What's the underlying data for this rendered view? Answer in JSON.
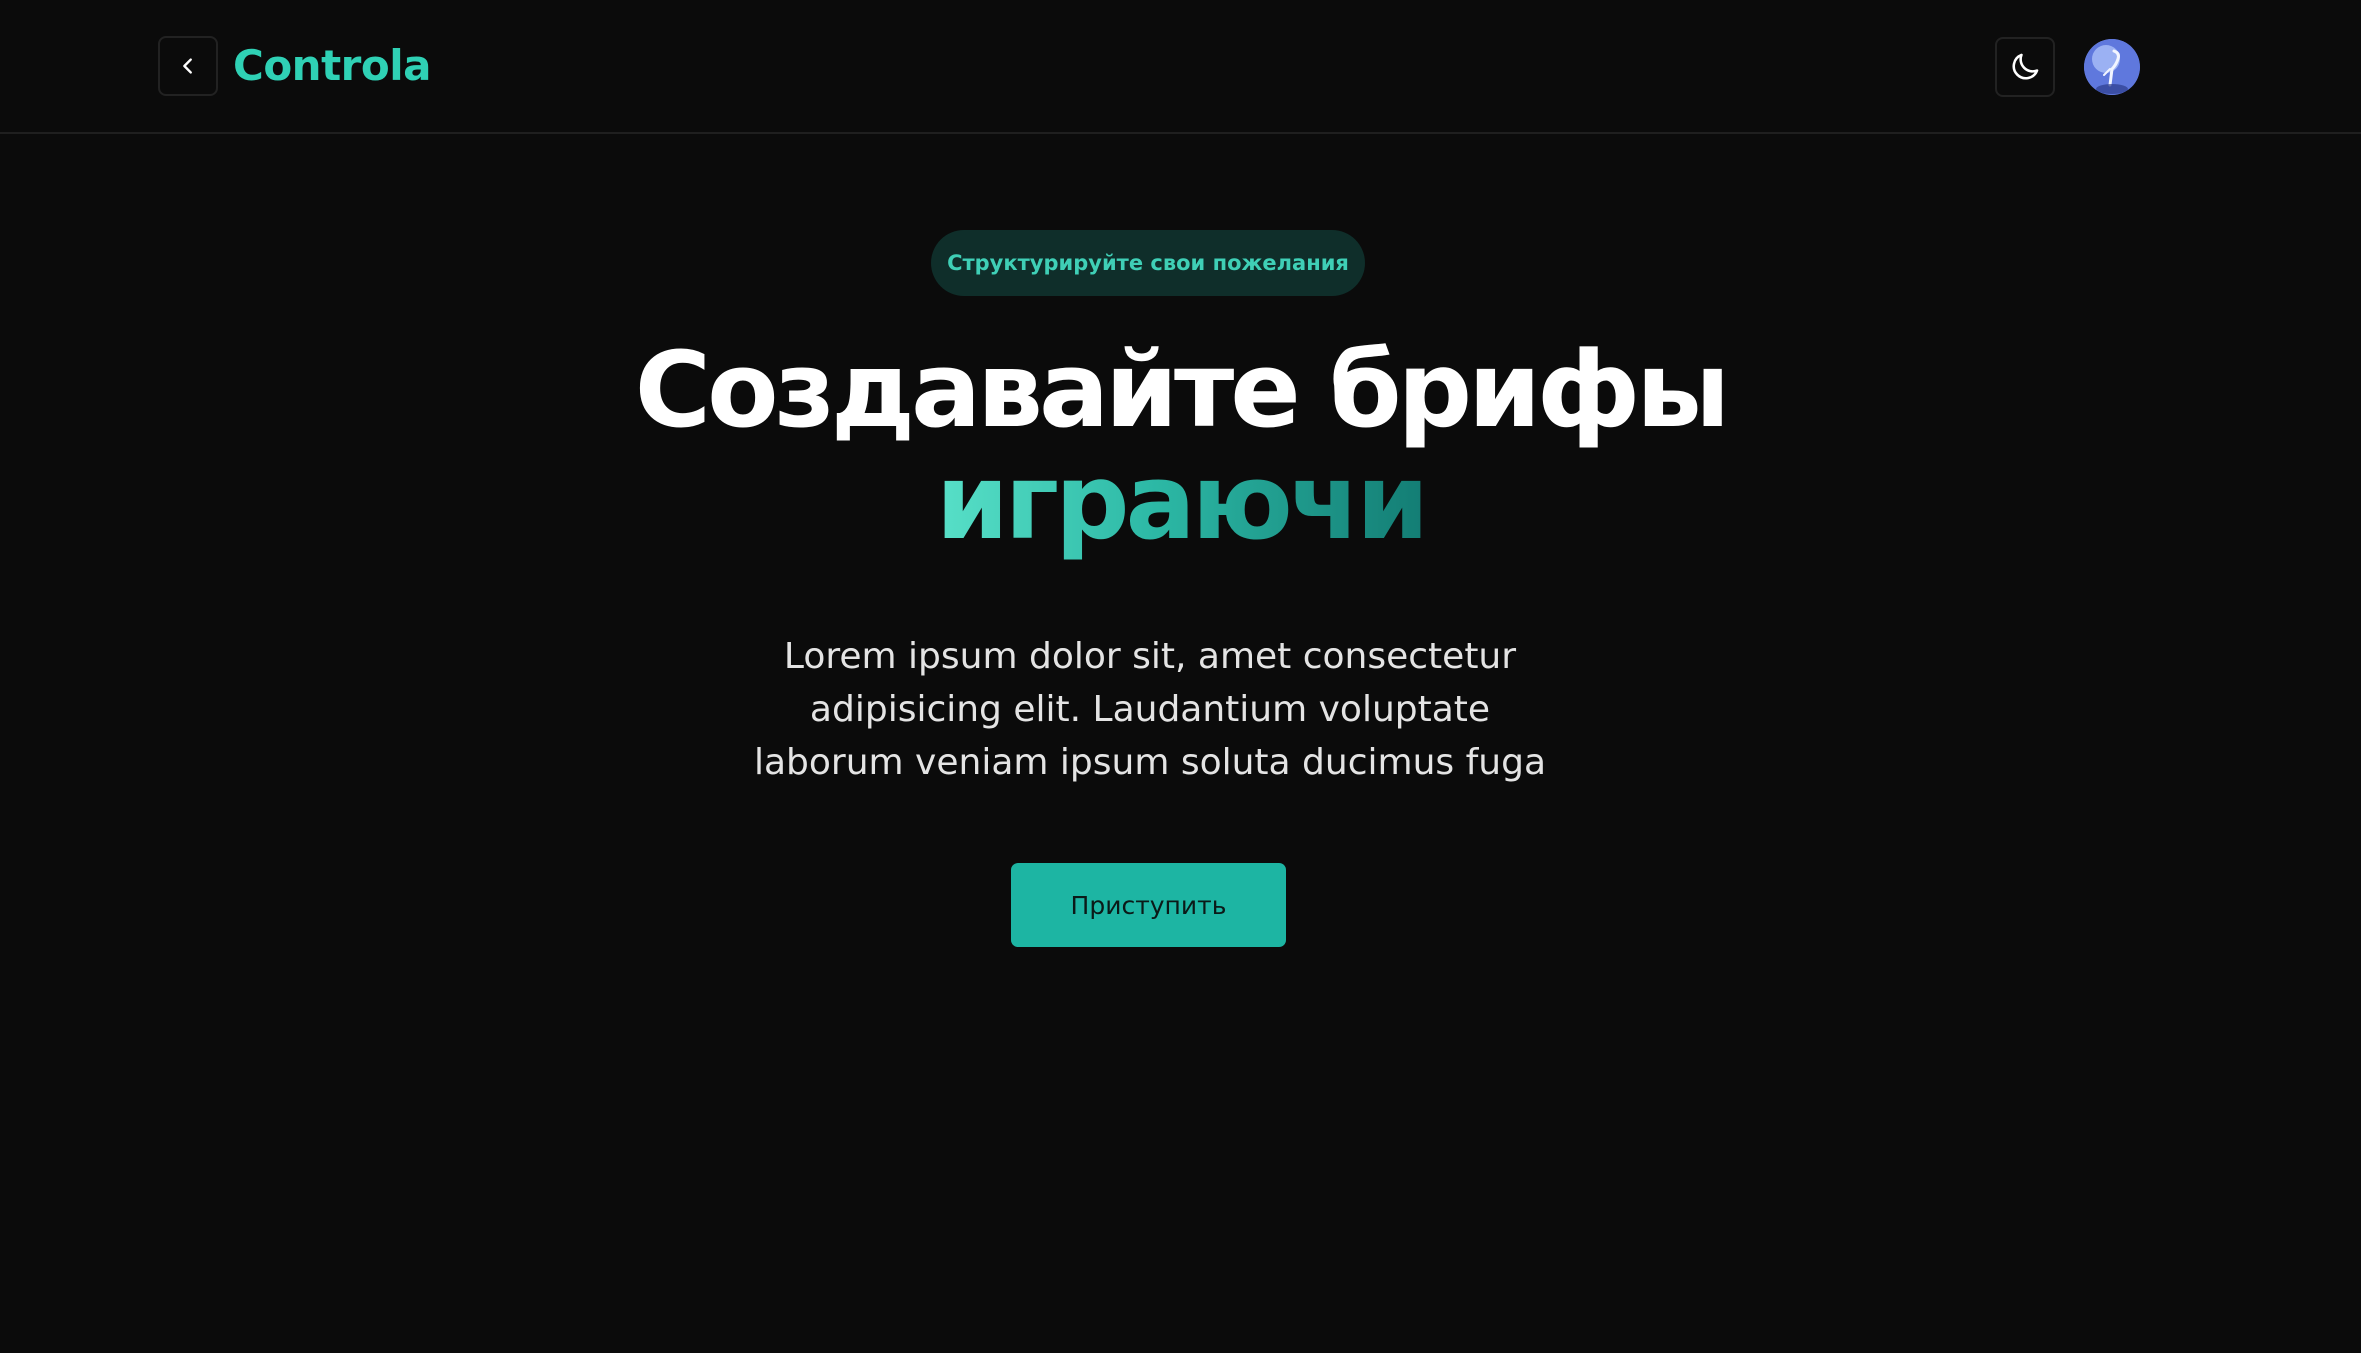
{
  "colors": {
    "background": "#0b0b0b",
    "accent": "#22c0aa",
    "logo": "#2fd1b5",
    "pill_bg": "#0f2e2a",
    "pill_text": "#3fcfb6",
    "button_bg": "#1db5a3",
    "button_text": "#0b1a18"
  },
  "header": {
    "back_icon": "chevron-left-icon",
    "logo_text": "Controla",
    "theme_icon": "moon-icon",
    "avatar_icon": "user-avatar"
  },
  "hero": {
    "pill_text": "Структурируйте свои пожелания",
    "title_line1": "Создавайте брифы",
    "title_line2": "играючи",
    "description": "Lorem ipsum dolor sit, amet consectetur adipisicing elit. Laudantium voluptate laborum veniam ipsum soluta ducimus fuga",
    "cta_label": "Приступить"
  }
}
